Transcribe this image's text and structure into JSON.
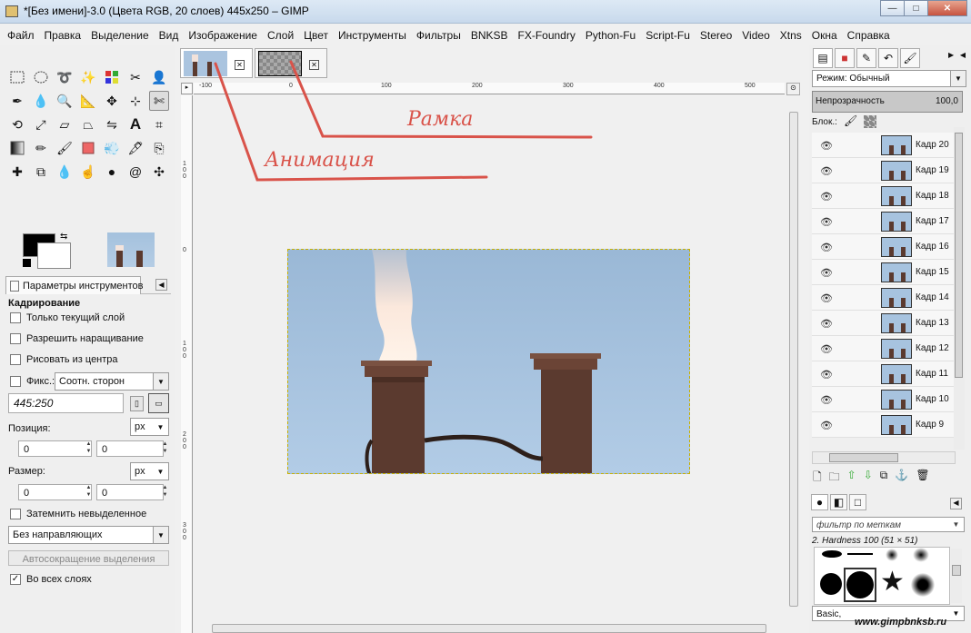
{
  "window": {
    "title": "*[Без имени]-3.0 (Цвета RGB, 20 слоев) 445x250 – GIMP",
    "buttons": {
      "minimize": "—",
      "maximize": "□",
      "close": "✕"
    }
  },
  "menubar": [
    "Файл",
    "Правка",
    "Выделение",
    "Вид",
    "Изображение",
    "Слой",
    "Цвет",
    "Инструменты",
    "Фильтры",
    "BNKSB",
    "FX-Foundry",
    "Python-Fu",
    "Script-Fu",
    "Stereo",
    "Video",
    "Xtns",
    "Окна",
    "Справка"
  ],
  "tool_options": {
    "tab_label": "Параметры инструментов",
    "title": "Кадрирование",
    "only_current_layer": "Только текущий слой",
    "allow_growing": "Разрешить наращивание",
    "draw_from_center": "Рисовать из центра",
    "fixed_label": "Фикс.:",
    "fixed_value": "Соотн. сторон",
    "ratio": "445:250",
    "position_label": "Позиция:",
    "position_unit": "px",
    "pos_x": "0",
    "pos_y": "0",
    "size_label": "Размер:",
    "size_unit": "px",
    "size_w": "0",
    "size_h": "0",
    "darken_unselected": "Затемнить невыделенное",
    "guides": "Без направляющих",
    "autoshrink": "Автосокращение выделения",
    "all_layers": "Во всех слоях",
    "all_layers_checked": "✓"
  },
  "rulers": {
    "top": [
      "-100",
      "0",
      "100",
      "200",
      "300",
      "400",
      "500"
    ],
    "left": [
      "1 0 0",
      "0",
      "1 0 0",
      "2 0 0",
      "3 0 0"
    ]
  },
  "annotations": {
    "frame": "Рамка",
    "animation": "Анимация"
  },
  "layers_panel": {
    "mode_label": "Режим:",
    "mode_value": "Обычный",
    "opacity_label": "Непрозрачность",
    "opacity_value": "100,0",
    "lock_label": "Блок.:",
    "layers": [
      "Кадр 20",
      "Кадр 19",
      "Кадр 18",
      "Кадр 17",
      "Кадр 16",
      "Кадр 15",
      "Кадр 14",
      "Кадр 13",
      "Кадр 12",
      "Кадр 11",
      "Кадр 10",
      "Кадр 9"
    ]
  },
  "brushes_panel": {
    "filter_placeholder": "фильтр по меткам",
    "brush_name": "2. Hardness 100 (51 × 51)",
    "preset": "Basic,"
  },
  "watermark": "www.gimpbnksb.ru",
  "colors": {
    "annotation_red": "#d9534a",
    "sky": "#a9c4df",
    "chimney": "#5b3a2f"
  }
}
